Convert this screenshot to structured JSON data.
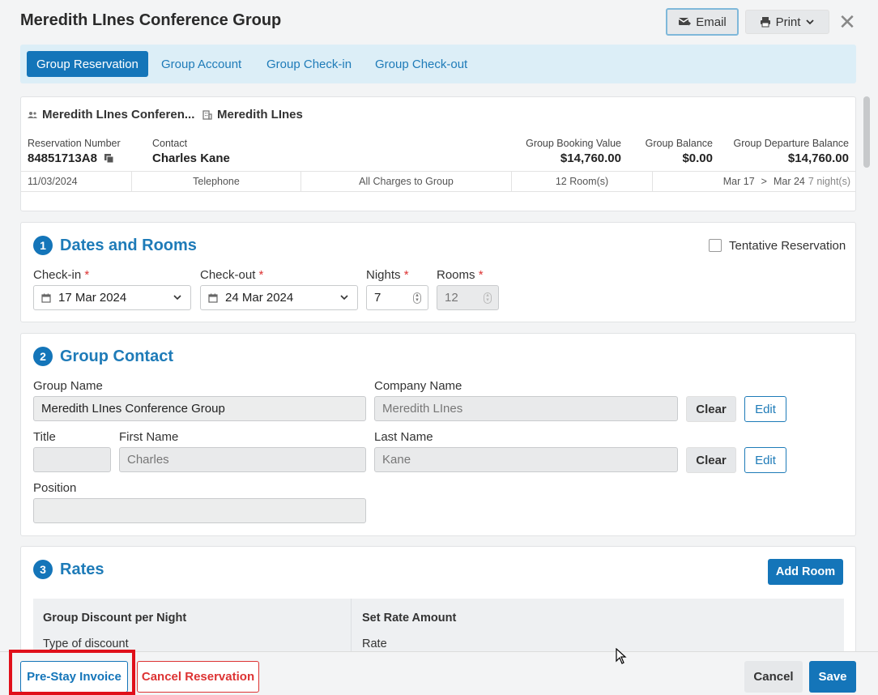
{
  "window": {
    "title": "Meredith LInes Conference Group",
    "email_label": "Email",
    "print_label": "Print",
    "close_glyph": "✕"
  },
  "tabs": [
    {
      "label": "Group Reservation"
    },
    {
      "label": "Group Account"
    },
    {
      "label": "Group Check-in"
    },
    {
      "label": "Group Check-out"
    }
  ],
  "summary": {
    "group_name": "Meredith LInes Conferen...",
    "company_name": "Meredith LInes",
    "reservation_number_label": "Reservation Number",
    "reservation_number": "84851713A8",
    "contact_label": "Contact",
    "contact": "Charles Kane",
    "booking_value_label": "Group Booking Value",
    "booking_value": "$14,760.00",
    "balance_label": "Group Balance",
    "balance": "$0.00",
    "departure_balance_label": "Group Departure Balance",
    "departure_balance": "$14,760.00",
    "strip": {
      "date": "11/03/2024",
      "source": "Telephone",
      "charges": "All Charges to Group",
      "rooms": "12 Room(s)",
      "arrive": "Mar 17",
      "arrow": ">",
      "depart": "Mar 24",
      "nights": "7 night(s)"
    }
  },
  "dates_rooms": {
    "number": "1",
    "title": "Dates and Rooms",
    "tentative_label": "Tentative Reservation",
    "checkin_label": "Check-in",
    "checkin_value": "17 Mar 2024",
    "checkout_label": "Check-out",
    "checkout_value": "24 Mar 2024",
    "nights_label": "Nights",
    "nights_value": "7",
    "rooms_label": "Rooms",
    "rooms_value": "12",
    "required_mark": "*"
  },
  "group_contact": {
    "number": "2",
    "title": "Group Contact",
    "group_name_label": "Group Name",
    "group_name_value": "Meredith LInes Conference Group",
    "company_name_label": "Company Name",
    "company_name_value": "Meredith LInes",
    "title_label": "Title",
    "title_value": "",
    "first_name_label": "First Name",
    "first_name_value": "Charles",
    "last_name_label": "Last Name",
    "last_name_value": "Kane",
    "position_label": "Position",
    "position_value": "",
    "clear_label": "Clear",
    "edit_label": "Edit"
  },
  "rates": {
    "number": "3",
    "title": "Rates",
    "add_room_label": "Add Room",
    "col1_header": "Group Discount per Night",
    "col1_sub": "Type of discount",
    "col2_header": "Set Rate Amount",
    "col2_sub": "Rate"
  },
  "footer": {
    "prestay_label": "Pre-Stay Invoice",
    "cancel_reservation_label": "Cancel Reservation",
    "cancel_label": "Cancel",
    "save_label": "Save"
  },
  "colors": {
    "primary": "#1475b9",
    "danger": "#d33333",
    "highlight": "#e0101a"
  }
}
